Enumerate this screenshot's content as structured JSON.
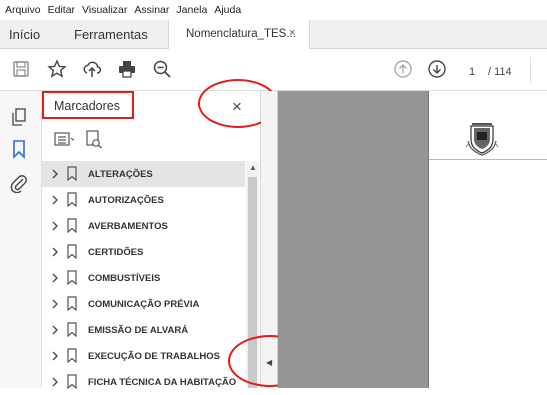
{
  "menu": [
    "Arquivo",
    "Editar",
    "Visualizar",
    "Assinar",
    "Janela",
    "Ajuda"
  ],
  "tabs": {
    "home": "Início",
    "tools": "Ferramentas",
    "document": "Nomenclatura_TES...",
    "document_close": "×"
  },
  "toolbar": {
    "icons": [
      "save-icon",
      "star-icon",
      "upload-icon",
      "print-icon",
      "zoom-icon",
      "arrow-up-icon",
      "arrow-down-icon"
    ],
    "page_current": "1",
    "page_total": "/ 114"
  },
  "left_rail": {
    "icons": [
      "pages-icon",
      "bookmark-icon",
      "attachment-icon"
    ]
  },
  "bookmarks_panel": {
    "title": "Marcadores",
    "close": "×",
    "items": [
      {
        "label": "ALTERAÇÕES"
      },
      {
        "label": "AUTORIZAÇÕES"
      },
      {
        "label": "AVERBAMENTOS"
      },
      {
        "label": "CERTIDÕES"
      },
      {
        "label": "COMBUSTÍVEIS"
      },
      {
        "label": "COMUNICAÇÃO PRÉVIA"
      },
      {
        "label": "EMISSÃO DE ALVARÁ"
      },
      {
        "label": "EXECUÇÃO DE TRABALHOS"
      },
      {
        "label": "FICHA TÉCNICA DA HABITAÇÃO"
      }
    ],
    "selected_index": 0
  },
  "colors": {
    "highlight_red": "#e21b1b",
    "active_icon_blue": "#2d6fd6",
    "document_gray": "#959595"
  }
}
